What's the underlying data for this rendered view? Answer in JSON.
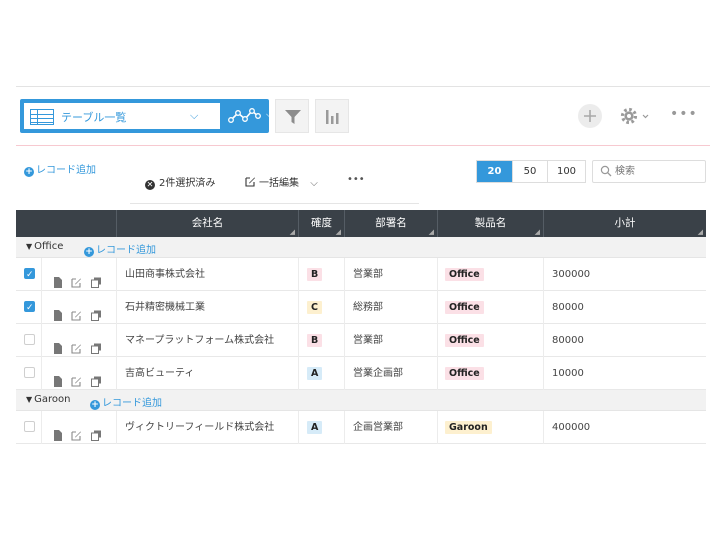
{
  "toolbar": {
    "view_label": "テーブル一覧",
    "colors": {
      "accent": "#3498db",
      "header_bg": "#3a4148"
    }
  },
  "actions": {
    "add_record": "レコード追加",
    "selected_count": "2件選択済み",
    "bulk_edit": "一括編集",
    "more": "•••"
  },
  "pager": {
    "options": [
      "20",
      "50",
      "100"
    ],
    "selected": "20"
  },
  "search": {
    "placeholder": "検索"
  },
  "table": {
    "columns": [
      "会社名",
      "確度",
      "部署名",
      "製品名",
      "小計"
    ],
    "groups": [
      {
        "name": "Office",
        "add_label": "レコード追加",
        "rows": [
          {
            "checked": true,
            "company": "山田商事株式会社",
            "rank": "B",
            "dept": "営業部",
            "product": "Office",
            "subtotal": "300000"
          },
          {
            "checked": true,
            "company": "石井精密機械工業",
            "rank": "C",
            "dept": "総務部",
            "product": "Office",
            "subtotal": "80000"
          },
          {
            "checked": false,
            "company": "マネープラットフォーム株式会社",
            "rank": "B",
            "dept": "営業部",
            "product": "Office",
            "subtotal": "80000"
          },
          {
            "checked": false,
            "company": "吉高ビューティ",
            "rank": "A",
            "dept": "営業企画部",
            "product": "Office",
            "subtotal": "10000"
          }
        ]
      },
      {
        "name": "Garoon",
        "add_label": "レコード追加",
        "rows": [
          {
            "checked": false,
            "company": "ヴィクトリーフィールド株式会社",
            "rank": "A",
            "dept": "企画営業部",
            "product": "Garoon",
            "subtotal": "400000"
          }
        ]
      }
    ],
    "rank_colors": {
      "A": "#d6ebf8",
      "B": "#fbe0e6",
      "C": "#fdf0cf"
    },
    "product_colors": {
      "Office": "#fbe0e6",
      "Garoon": "#fdf0cf"
    }
  }
}
